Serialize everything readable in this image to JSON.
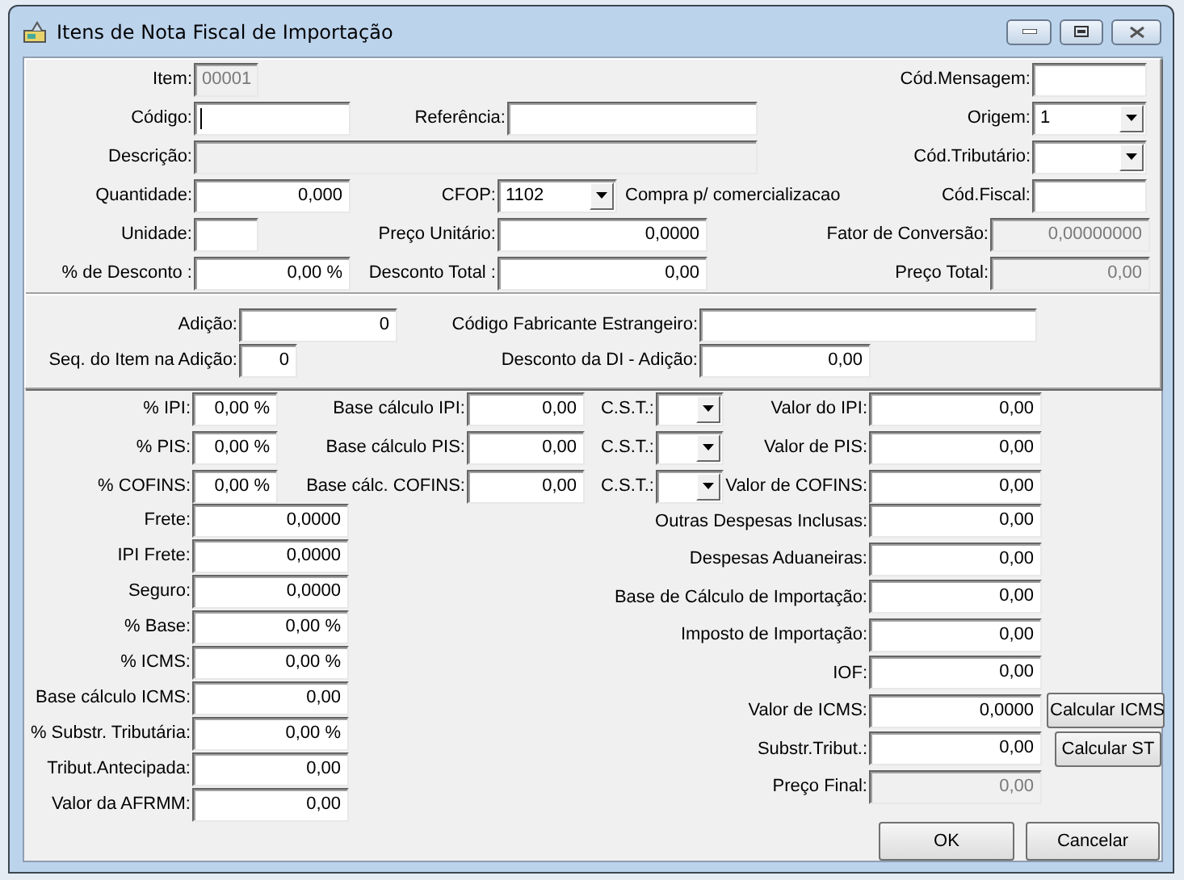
{
  "window": {
    "title": "Itens de Nota Fiscal de Importação"
  },
  "fields": {
    "item": {
      "label": "Item:",
      "value": "00001",
      "kind": "text",
      "disabled": true
    },
    "cod_mensagem": {
      "label": "Cód.Mensagem:",
      "kind": "text",
      "disabled": false
    },
    "codigo": {
      "label": "Código:",
      "kind": "text",
      "disabled": false,
      "focused": true
    },
    "referencia": {
      "label": "Referência:",
      "kind": "text",
      "disabled": false
    },
    "origem": {
      "label": "Origem:",
      "value": "1",
      "kind": "combo",
      "disabled": false
    },
    "descricao": {
      "label": "Descrição:",
      "kind": "text",
      "disabled": true
    },
    "cod_tributario": {
      "label": "Cód.Tributário:",
      "kind": "combo",
      "disabled": false
    },
    "quantidade": {
      "label": "Quantidade:",
      "value": "0,000",
      "kind": "number",
      "disabled": false
    },
    "cfop": {
      "label": "CFOP:",
      "value": "1102",
      "kind": "combo",
      "disabled": false
    },
    "cod_fiscal": {
      "label": "Cód.Fiscal:",
      "kind": "text",
      "disabled": false
    },
    "unidade": {
      "label": "Unidade:",
      "kind": "text",
      "disabled": false
    },
    "preco_unitario": {
      "label": "Preço Unitário:",
      "value": "0,0000",
      "kind": "number",
      "disabled": false
    },
    "fator_conversao": {
      "label": "Fator de Conversão:",
      "value": "0,00000000",
      "kind": "number",
      "disabled": true
    },
    "desconto_percent": {
      "label": "% de Desconto :",
      "value": "0,00 %",
      "kind": "number",
      "disabled": false
    },
    "desconto_total": {
      "label": "Desconto Total :",
      "value": "0,00",
      "kind": "number",
      "disabled": false
    },
    "preco_total": {
      "label": "Preço Total:",
      "value": "0,00",
      "kind": "number",
      "disabled": true
    },
    "adicao": {
      "label": "Adição:",
      "value": "0",
      "kind": "number",
      "disabled": false
    },
    "cod_fabricante": {
      "label": "Código Fabricante Estrangeiro:",
      "kind": "text",
      "disabled": false
    },
    "seq_item": {
      "label": "Seq. do Item na Adição:",
      "value": "0",
      "kind": "number",
      "disabled": false
    },
    "desconto_di": {
      "label": "Desconto da DI - Adição:",
      "value": "0,00",
      "kind": "number",
      "disabled": false
    },
    "ipi_percent": {
      "label": "% IPI:",
      "value": "0,00 %",
      "kind": "number",
      "disabled": false
    },
    "ipi_base": {
      "label": "Base cálculo IPI:",
      "value": "0,00",
      "kind": "number",
      "disabled": false
    },
    "ipi_cst": {
      "label": "C.S.T.:",
      "kind": "combo",
      "disabled": false
    },
    "ipi_valor": {
      "label": "Valor do IPI:",
      "value": "0,00",
      "kind": "number",
      "disabled": false
    },
    "pis_percent": {
      "label": "% PIS:",
      "value": "0,00 %",
      "kind": "number",
      "disabled": false
    },
    "pis_base": {
      "label": "Base cálculo PIS:",
      "value": "0,00",
      "kind": "number",
      "disabled": false
    },
    "pis_cst": {
      "label": "C.S.T.:",
      "kind": "combo",
      "disabled": false
    },
    "pis_valor": {
      "label": "Valor de PIS:",
      "value": "0,00",
      "kind": "number",
      "disabled": false
    },
    "cofins_percent": {
      "label": "% COFINS:",
      "value": "0,00 %",
      "kind": "number",
      "disabled": false
    },
    "cofins_base": {
      "label": "Base cálc. COFINS:",
      "value": "0,00",
      "kind": "number",
      "disabled": false
    },
    "cofins_cst": {
      "label": "C.S.T.:",
      "kind": "combo",
      "disabled": false
    },
    "cofins_valor": {
      "label": "Valor de COFINS:",
      "value": "0,00",
      "kind": "number",
      "disabled": false
    },
    "frete": {
      "label": "Frete:",
      "value": "0,0000",
      "kind": "number",
      "disabled": false
    },
    "ipi_frete": {
      "label": "IPI Frete:",
      "value": "0,0000",
      "kind": "number",
      "disabled": false
    },
    "seguro": {
      "label": "Seguro:",
      "value": "0,0000",
      "kind": "number",
      "disabled": false
    },
    "base_percent": {
      "label": "% Base:",
      "value": "0,00 %",
      "kind": "number",
      "disabled": false
    },
    "icms_percent": {
      "label": "% ICMS:",
      "value": "0,00 %",
      "kind": "number",
      "disabled": false
    },
    "icms_base": {
      "label": "Base cálculo ICMS:",
      "value": "0,00",
      "kind": "number",
      "disabled": false
    },
    "st_percent": {
      "label": "% Substr. Tributária:",
      "value": "0,00 %",
      "kind": "number",
      "disabled": false
    },
    "tribut_antecipada": {
      "label": "Tribut.Antecipada:",
      "value": "0,00",
      "kind": "number",
      "disabled": false
    },
    "afrmm": {
      "label": "Valor da AFRMM:",
      "value": "0,00",
      "kind": "number",
      "disabled": false
    },
    "outras_despesas": {
      "label": "Outras Despesas Inclusas:",
      "value": "0,00",
      "kind": "number",
      "disabled": false
    },
    "despesas_aduaneiras": {
      "label": "Despesas Aduaneiras:",
      "value": "0,00",
      "kind": "number",
      "disabled": false
    },
    "base_importacao": {
      "label": "Base de Cálculo de Importação:",
      "value": "0,00",
      "kind": "number",
      "disabled": false
    },
    "imposto_importacao": {
      "label": "Imposto de Importação:",
      "value": "0,00",
      "kind": "number",
      "disabled": false
    },
    "iof": {
      "label": "IOF:",
      "value": "0,00",
      "kind": "number",
      "disabled": false
    },
    "valor_icms": {
      "label": "Valor de ICMS:",
      "value": "0,0000",
      "kind": "number",
      "disabled": false
    },
    "substr_tribut": {
      "label": "Substr.Tribut.:",
      "value": "0,00",
      "kind": "number",
      "disabled": false
    },
    "preco_final": {
      "label": "Preço Final:",
      "value": "0,00",
      "kind": "number",
      "disabled": true
    }
  },
  "cfop_description": "Compra p/ comercializacao",
  "buttons": {
    "calcular_icms": {
      "label": "Calcular ICMS"
    },
    "calcular_st": {
      "label": "Calcular ST"
    },
    "ok": {
      "label": "OK"
    },
    "cancelar": {
      "label": "Cancelar"
    }
  }
}
